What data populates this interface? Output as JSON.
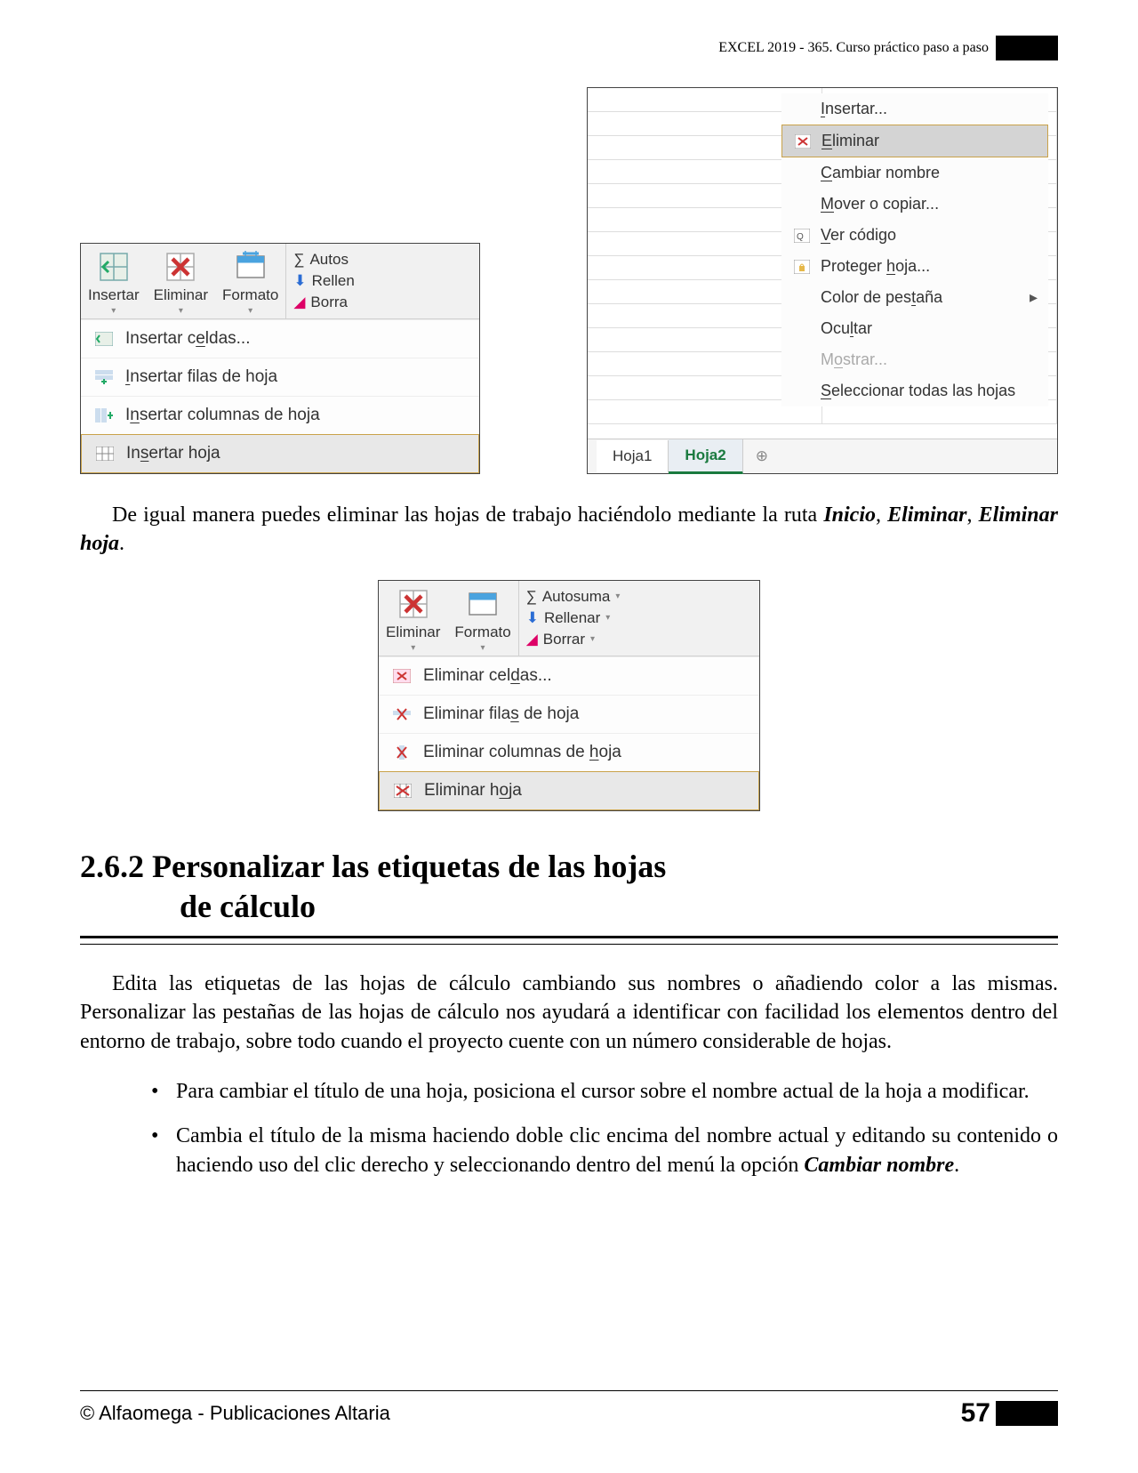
{
  "header": {
    "title": "EXCEL 2019 - 365. Curso práctico paso a paso"
  },
  "fig1": {
    "ribbon": {
      "insertar": "Insertar",
      "eliminar": "Eliminar",
      "formato": "Formato"
    },
    "side": {
      "autos": "Autos",
      "rellen": "Rellen",
      "borrar": "Borra"
    },
    "menu": [
      {
        "label": "Insertar c",
        "u": "e",
        "after": "ldas..."
      },
      {
        "label": "",
        "u": "I",
        "after": "nsertar filas de hoja"
      },
      {
        "label": "I",
        "u": "n",
        "after": "sertar columnas de hoja"
      },
      {
        "label": "In",
        "u": "s",
        "after": "ertar hoja"
      }
    ]
  },
  "fig2": {
    "menu": [
      {
        "pre": "",
        "u": "I",
        "post": "nsertar...",
        "icon": ""
      },
      {
        "pre": "",
        "u": "E",
        "post": "liminar",
        "icon": "delete-sheet",
        "hover": true
      },
      {
        "pre": "",
        "u": "C",
        "post": "ambiar nombre",
        "icon": ""
      },
      {
        "pre": "",
        "u": "M",
        "post": "over o copiar...",
        "icon": ""
      },
      {
        "pre": "",
        "u": "V",
        "post": "er código",
        "icon": "code"
      },
      {
        "pre": "Proteger ",
        "u": "h",
        "post": "oja...",
        "icon": "protect"
      },
      {
        "pre": "Color de pes",
        "u": "t",
        "post": "aña",
        "icon": "",
        "arrow": true
      },
      {
        "pre": "Ocu",
        "u": "l",
        "post": "tar",
        "icon": ""
      },
      {
        "pre": "M",
        "u": "o",
        "post": "strar...",
        "icon": "",
        "disabled": true
      },
      {
        "pre": "",
        "u": "S",
        "post": "eleccionar todas las hojas",
        "icon": ""
      }
    ],
    "tabs": {
      "t1": "Hoja1",
      "t2": "Hoja2",
      "add": "⊕"
    }
  },
  "para1": {
    "text_a": "De igual manera puedes eliminar las hojas de trabajo haciéndolo mediante la ruta ",
    "b1": "Inicio",
    "s1": ", ",
    "b2": "Eliminar",
    "s2": ", ",
    "b3": "Eliminar hoja",
    "end": "."
  },
  "fig3": {
    "ribbon": {
      "eliminar": "Eliminar",
      "formato": "Formato"
    },
    "side": {
      "autosuma": "Autosuma",
      "rellenar": "Rellenar",
      "borrar": "Borrar"
    },
    "menu": [
      {
        "pre": "Eliminar cel",
        "u": "d",
        "post": "as..."
      },
      {
        "pre": "Eliminar fila",
        "u": "s",
        "post": " de hoja"
      },
      {
        "pre": "Eliminar columnas de ",
        "u": "h",
        "post": "oja"
      },
      {
        "pre": "Eliminar h",
        "u": "o",
        "post": "ja"
      }
    ]
  },
  "heading": {
    "num": "2.6.2 ",
    "l1": "Personalizar las etiquetas de las hojas",
    "l2": "de cálculo"
  },
  "para2": "Edita las etiquetas de las hojas de cálculo cambiando sus nombres o añadiendo color a las mismas. Personalizar las pestañas de las hojas de cálculo nos ayudará a identificar con facilidad los elementos dentro del entorno de trabajo, sobre todo cuando el proyecto cuente con un número considerable de hojas.",
  "bullets": {
    "b1": "Para cambiar el título de una hoja, posiciona el cursor sobre el nombre actual de la hoja a modificar.",
    "b2_a": "Cambia el título de la misma haciendo doble clic encima del nombre actual y editando su contenido o haciendo uso del clic derecho y seleccionando dentro del menú la opción ",
    "b2_b": "Cambiar nombre",
    "b2_c": "."
  },
  "footer": {
    "copyright": "© Alfaomega - Publicaciones Altaria",
    "page": "57"
  }
}
